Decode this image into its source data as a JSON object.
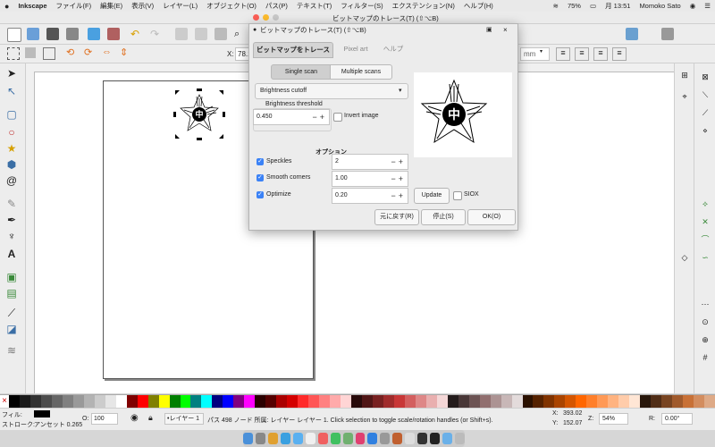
{
  "menubar": {
    "apple": "",
    "app": "Inkscape",
    "items": [
      "ファイル(F)",
      "編集(E)",
      "表示(V)",
      "レイヤー(L)",
      "オブジェクト(O)",
      "パス(P)",
      "テキスト(T)",
      "フィルター(S)",
      "エクステンション(N)",
      "ヘルプ(H)"
    ],
    "battery": "75%",
    "clock": "月 13:51",
    "user": "Momoko Sato"
  },
  "window": {
    "title": "ビットマップのトレース(T) (⇧⌥B)"
  },
  "controls": {
    "x_label": "X:",
    "x_value": "78.10",
    "unit": "mm"
  },
  "dialog": {
    "title": "ビットマップのトレース(T) (⇧⌥B)",
    "tabs": [
      "ビットマップをトレース",
      "Pixel art",
      "ヘルプ"
    ],
    "scan_modes": [
      "Single scan",
      "Multiple scans"
    ],
    "mode_select": "Brightness cutoff",
    "threshold_label": "Brightness threshold",
    "threshold_value": "0.450",
    "invert_label": "Invert image",
    "options_label": "オプション",
    "options": [
      {
        "label": "Speckles",
        "value": "2",
        "checked": true
      },
      {
        "label": "Smooth corners",
        "value": "1.00",
        "checked": true
      },
      {
        "label": "Optimize",
        "value": "0.20",
        "checked": true
      }
    ],
    "update_button": "Update",
    "siox_label": "SIOX",
    "buttons": {
      "revert": "元に戻す(R)",
      "stop": "停止(S)",
      "ok": "OK(O)"
    }
  },
  "canvas": {
    "glyph": "中"
  },
  "status": {
    "fill_label": "フィル:",
    "stroke_label": "ストローク:",
    "stroke_value": "アンセット 0.265",
    "opacity_label": "O:",
    "opacity_value": "100",
    "layer": "•レイヤー 1",
    "message": "パス 498 ノード 所属: レイヤー レイヤー 1. Click selection to toggle scale/rotation handles (or Shift+s).",
    "x_label": "X:",
    "x_value": "393.02",
    "y_label": "Y:",
    "y_value": "152.07",
    "zoom_label": "Z:",
    "zoom_value": "54%",
    "rot_label": "R:",
    "rot_value": "0.00°"
  },
  "colors": {
    "accent": "#3b82f6",
    "palette": [
      "#000000",
      "#1a1a1a",
      "#333333",
      "#4d4d4d",
      "#666666",
      "#808080",
      "#999999",
      "#b3b3b3",
      "#cccccc",
      "#e6e6e6",
      "#ffffff",
      "#800000",
      "#ff0000",
      "#808000",
      "#ffff00",
      "#008000",
      "#00ff00",
      "#008080",
      "#00ffff",
      "#000080",
      "#0000ff",
      "#800080",
      "#ff00ff",
      "#2b0000",
      "#550000",
      "#aa0000",
      "#d40000",
      "#ff2a2a",
      "#ff5555",
      "#ff8080",
      "#ffaaaa",
      "#ffd5d5",
      "#280b0b",
      "#501616",
      "#782121",
      "#a02c2c",
      "#c83737",
      "#d35f5f",
      "#de8787",
      "#e9afaf",
      "#f4d7d7",
      "#241c1c",
      "#483737",
      "#6c5353",
      "#916f6f",
      "#ac9393",
      "#c8b7b7",
      "#e3dbdb",
      "#2b1100",
      "#552200",
      "#803300",
      "#aa4400",
      "#d45500",
      "#ff6600",
      "#ff7f2a",
      "#ff9955",
      "#ffb380",
      "#ffccaa",
      "#ffe6d5",
      "#28170b",
      "#502d16",
      "#784421",
      "#a05a2c",
      "#c87137",
      "#d38d5f",
      "#deaa87"
    ]
  }
}
